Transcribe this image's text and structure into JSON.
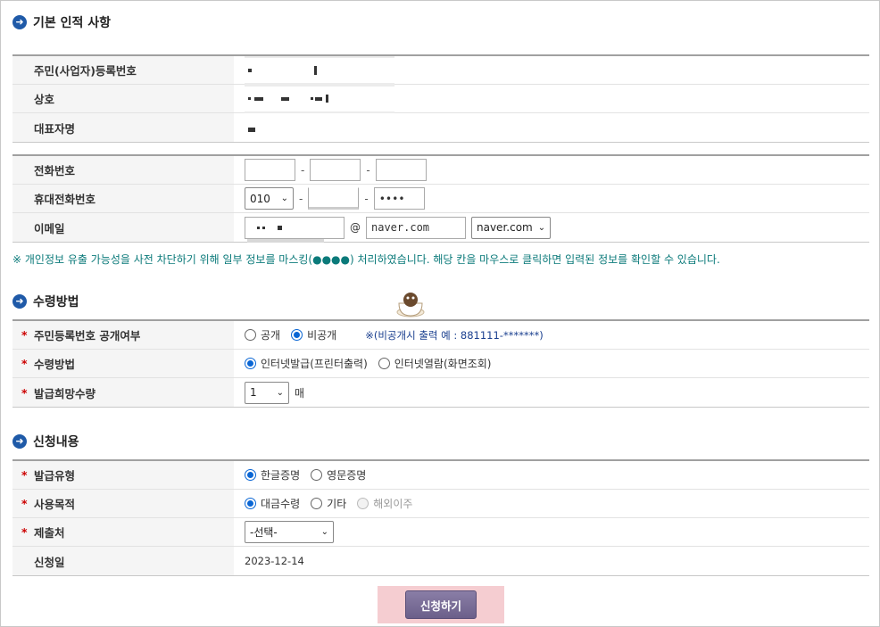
{
  "sections": {
    "basic": {
      "title": "기본 인적 사항"
    },
    "receipt": {
      "title": "수령방법"
    },
    "request": {
      "title": "신청내용"
    }
  },
  "basic": {
    "id_label": "주민(사업자)등록번호",
    "name_label": "상호",
    "rep_label": "대표자명",
    "phone_label": "전화번호",
    "mobile_label": "휴대전화번호",
    "mobile_prefix": "010",
    "mobile_last": "••••",
    "email_label": "이메일",
    "email_at": "@",
    "email_domain": "naver.com",
    "email_domain_select": "naver.com"
  },
  "notice": "※ 개인정보 유출 가능성을 사전 차단하기 위해 일부 정보를 마스킹(●●●●) 처리하였습니다. 해당 칸을 마우스로 클릭하면 입력된 정보를 확인할 수 있습니다.",
  "receipt": {
    "disclosure_label": "주민등록번호 공개여부",
    "disclosure_options": [
      "공개",
      "비공개"
    ],
    "disclosure_selected": "비공개",
    "disclosure_note": "※(비공개시 출력 예 : 881111-*******)",
    "method_label": "수령방법",
    "method_options": [
      "인터넷발급(프린터출력)",
      "인터넷열람(화면조회)"
    ],
    "method_selected": "인터넷발급(프린터출력)",
    "qty_label": "발급희망수량",
    "qty_value": "1",
    "qty_unit": "매"
  },
  "request": {
    "type_label": "발급유형",
    "type_options": [
      "한글증명",
      "영문증명"
    ],
    "type_selected": "한글증명",
    "purpose_label": "사용목적",
    "purpose_options": [
      "대금수령",
      "기타",
      "해외이주"
    ],
    "purpose_selected": "대금수령",
    "submit_to_label": "제출처",
    "submit_to_value": "-선택-",
    "date_label": "신청일",
    "date_value": "2023-12-14"
  },
  "submit_label": "신청하기",
  "required_mark": "*",
  "colors": {
    "accent": "#1f5aa8",
    "radio": "#0a66d4",
    "notice": "#0b7a7a",
    "required": "#cc0000",
    "button": "#7a6e98",
    "button_area": "#f5cdd1"
  },
  "icons": {
    "section": "circle-arrow-right-icon",
    "dropdown": "chevron-down-icon"
  }
}
